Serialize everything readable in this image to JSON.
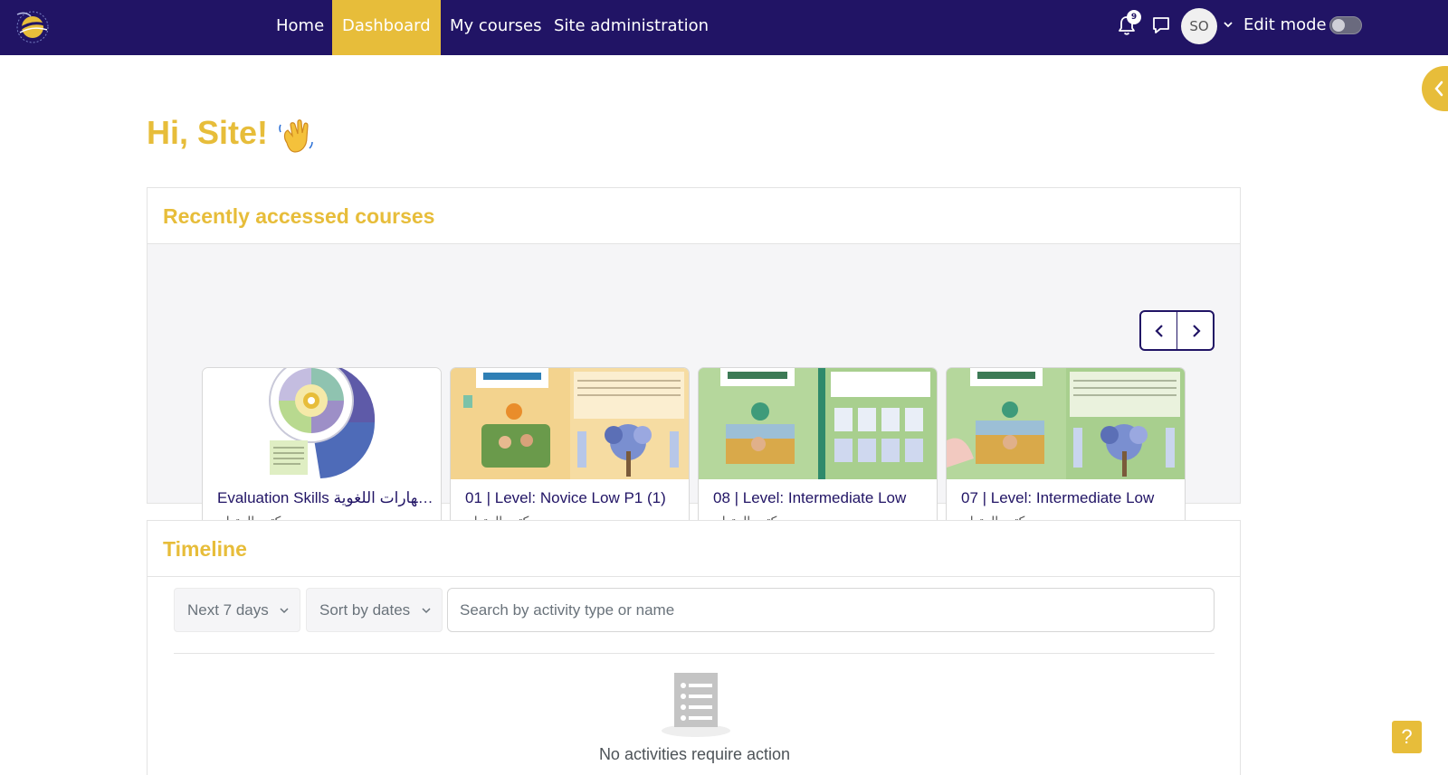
{
  "nav": {
    "items": [
      {
        "label": "Home",
        "active": false
      },
      {
        "label": "Dashboard",
        "active": true
      },
      {
        "label": "My courses",
        "active": false
      },
      {
        "label": "Site administration",
        "active": false
      }
    ],
    "notification_count": "9",
    "avatar_initials": "SO",
    "edit_mode_label": "Edit mode",
    "edit_mode_on": false
  },
  "greeting": "Hi, Site!",
  "recent": {
    "title": "Recently accessed courses",
    "courses": [
      {
        "name": "Evaluation Skills لمهارات اللغوية...",
        "category": "كتب المتعلم"
      },
      {
        "name": "01 | Level: Novice Low P1 (1)",
        "category": "كتب المتعلم"
      },
      {
        "name": "08 | Level: Intermediate Low",
        "category": "كتب المتعلم"
      },
      {
        "name": "07 | Level: Intermediate Low",
        "category": "كتب المتعلم"
      }
    ]
  },
  "timeline": {
    "title": "Timeline",
    "day_filter": "Next 7 days",
    "sort_filter": "Sort by dates",
    "search_placeholder": "Search by activity type or name",
    "empty_message": "No activities require action"
  },
  "help_label": "?",
  "colors": {
    "navbar": "#211465",
    "accent": "#e7bd3a",
    "link": "#211465"
  }
}
